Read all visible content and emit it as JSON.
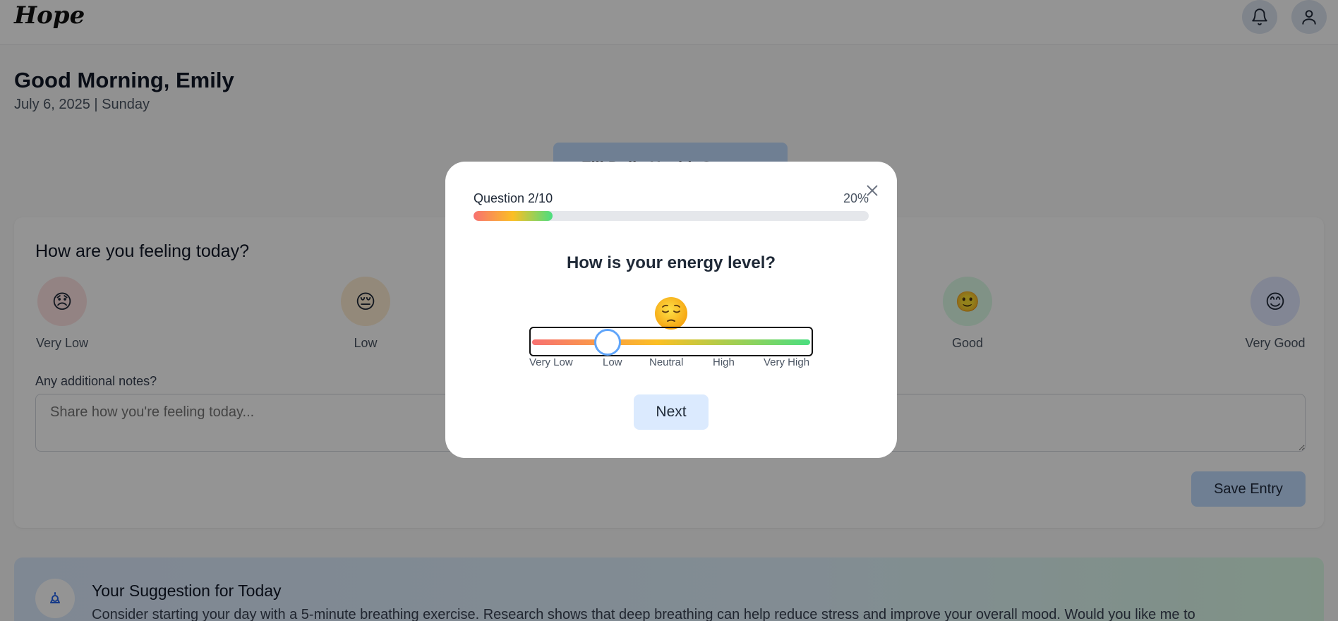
{
  "app": {
    "logo_text": "Hope"
  },
  "header": {
    "notification_icon": "bell-icon",
    "profile_icon": "user-icon"
  },
  "greeting": {
    "title": "Good Morning, Emily",
    "date": "July 6, 2025 | Sunday"
  },
  "survey_button": {
    "label": "Fill Daily Health Survey"
  },
  "mood": {
    "title": "How are you feeling today?",
    "options": [
      {
        "label": "Very Low",
        "emoji": "😞",
        "color": "#fde2e2"
      },
      {
        "label": "Low",
        "emoji": "😔",
        "color": "#fdecd2"
      },
      {
        "label": "Good",
        "emoji": "🙂",
        "color": "#dcfce7"
      },
      {
        "label": "Very Good",
        "emoji": "😊",
        "color": "#e0e7ff"
      }
    ],
    "notes_label": "Any additional notes?",
    "notes_placeholder": "Share how you're feeling today...",
    "save_label": "Save Entry"
  },
  "suggestion": {
    "title": "Your Suggestion for Today",
    "text": "Consider starting your day with a 5-minute breathing exercise. Research shows that deep breathing can help reduce stress and improve your overall mood. Would you like me to"
  },
  "modal": {
    "counter": "Question 2/10",
    "percent_label": "20%",
    "progress": 0.2,
    "question": "How is your energy level?",
    "emoji": "😔",
    "slider_value_index": 1,
    "slider_labels": [
      "Very Low",
      "Low",
      "Neutral",
      "High",
      "Very High"
    ],
    "next_label": "Next",
    "close_icon": "close-icon"
  },
  "colors": {
    "accent": "#60a5fa",
    "button_bg": "#dbeafe",
    "progress_start": "#f87171",
    "progress_mid": "#fbbf24",
    "progress_end": "#4ade80"
  }
}
